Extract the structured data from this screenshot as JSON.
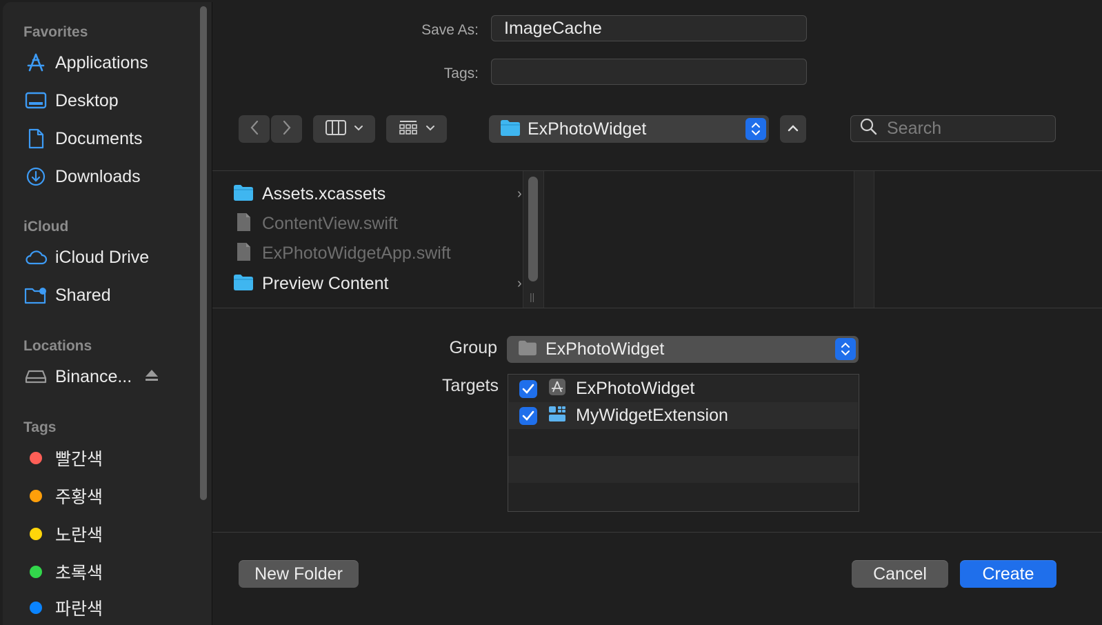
{
  "sidebar": {
    "sections": {
      "favorites": "Favorites",
      "icloud": "iCloud",
      "locations": "Locations",
      "tags": "Tags"
    },
    "favorites": [
      {
        "label": "Applications",
        "icon": "applications-icon"
      },
      {
        "label": "Desktop",
        "icon": "desktop-icon"
      },
      {
        "label": "Documents",
        "icon": "document-icon"
      },
      {
        "label": "Downloads",
        "icon": "download-icon"
      }
    ],
    "icloud": [
      {
        "label": "iCloud Drive",
        "icon": "cloud-icon"
      },
      {
        "label": "Shared",
        "icon": "shared-folder-icon"
      }
    ],
    "locations": [
      {
        "label": "Binance...",
        "icon": "drive-icon"
      }
    ],
    "tags": [
      {
        "label": "빨간색",
        "color": "#ff5f57"
      },
      {
        "label": "주황색",
        "color": "#ff9f0a"
      },
      {
        "label": "노란색",
        "color": "#ffd60a"
      },
      {
        "label": "초록색",
        "color": "#32d74b"
      },
      {
        "label": "파란색",
        "color": "#0a84ff"
      }
    ]
  },
  "form": {
    "save_as_label": "Save As:",
    "save_as_value": "ImageCache",
    "tags_label": "Tags:",
    "tags_value": ""
  },
  "toolbar": {
    "location": "ExPhotoWidget",
    "search_placeholder": "Search"
  },
  "files": [
    {
      "name": "Assets.xcassets",
      "kind": "folder",
      "enabled": true,
      "has_children": true
    },
    {
      "name": "ContentView.swift",
      "kind": "swift",
      "enabled": false,
      "has_children": false
    },
    {
      "name": "ExPhotoWidgetApp.swift",
      "kind": "swift",
      "enabled": false,
      "has_children": false
    },
    {
      "name": "Preview Content",
      "kind": "folder",
      "enabled": true,
      "has_children": true
    }
  ],
  "options": {
    "group_label": "Group",
    "group_value": "ExPhotoWidget",
    "targets_label": "Targets",
    "targets": [
      {
        "name": "ExPhotoWidget",
        "checked": true,
        "icon": "app-target-icon"
      },
      {
        "name": "MyWidgetExtension",
        "checked": true,
        "icon": "widget-extension-icon"
      }
    ]
  },
  "buttons": {
    "new_folder": "New Folder",
    "cancel": "Cancel",
    "create": "Create"
  },
  "colors": {
    "accent": "#1f6feb",
    "folder": "#3fb6f0",
    "sidebar_icon": "#3d9bf5"
  }
}
